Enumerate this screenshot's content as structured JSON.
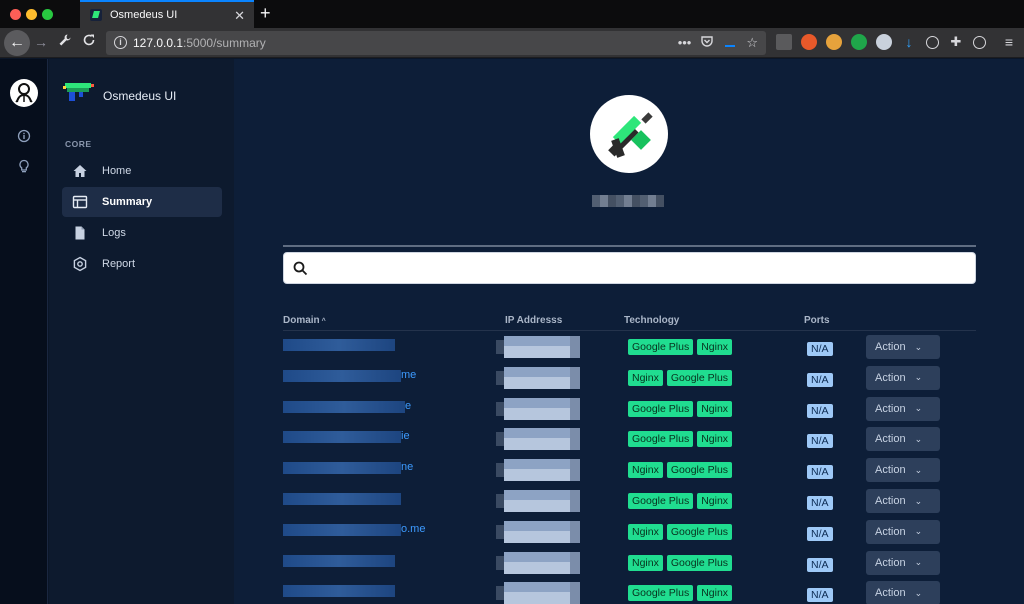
{
  "browser": {
    "tab_title": "Osmedeus UI",
    "new_tab": "+",
    "tab_close": "✕",
    "url_host": "127.0.0.1",
    "url_path": ":5000/summary",
    "url_actions": "•••"
  },
  "sidebar": {
    "brand": "Osmedeus UI",
    "section": "CORE",
    "items": [
      {
        "label": "Home",
        "icon": "home-icon"
      },
      {
        "label": "Summary",
        "icon": "table-icon",
        "active": true
      },
      {
        "label": "Logs",
        "icon": "file-icon"
      },
      {
        "label": "Report",
        "icon": "hexagon-icon"
      }
    ]
  },
  "search": {
    "placeholder": "",
    "value": ""
  },
  "table": {
    "headers": [
      "Domain",
      "IP Addresss",
      "Technology",
      "Ports"
    ],
    "sort_indicator": "^",
    "action_label": "Action",
    "rows": [
      {
        "domain_tail": "",
        "tech": [
          "Google Plus",
          "Nginx"
        ],
        "port": "N/A"
      },
      {
        "domain_tail": "me",
        "tech": [
          "Nginx",
          "Google Plus"
        ],
        "port": "N/A"
      },
      {
        "domain_tail": "e",
        "tech": [
          "Google Plus",
          "Nginx"
        ],
        "port": "N/A"
      },
      {
        "domain_tail": "ie",
        "tech": [
          "Google Plus",
          "Nginx"
        ],
        "port": "N/A"
      },
      {
        "domain_tail": "ne",
        "tech": [
          "Nginx",
          "Google Plus"
        ],
        "port": "N/A"
      },
      {
        "domain_tail": "",
        "tech": [
          "Google Plus",
          "Nginx"
        ],
        "port": "N/A"
      },
      {
        "domain_tail": "o.me",
        "tech": [
          "Nginx",
          "Google Plus"
        ],
        "port": "N/A"
      },
      {
        "domain_tail": "",
        "tech": [
          "Nginx",
          "Google Plus"
        ],
        "port": "N/A"
      },
      {
        "domain_tail": "",
        "tech": [
          "Google Plus",
          "Nginx"
        ],
        "port": "N/A"
      }
    ]
  },
  "colors": {
    "accent": "#20dd90",
    "link": "#3d9bff",
    "bg": "#0d1e38"
  }
}
